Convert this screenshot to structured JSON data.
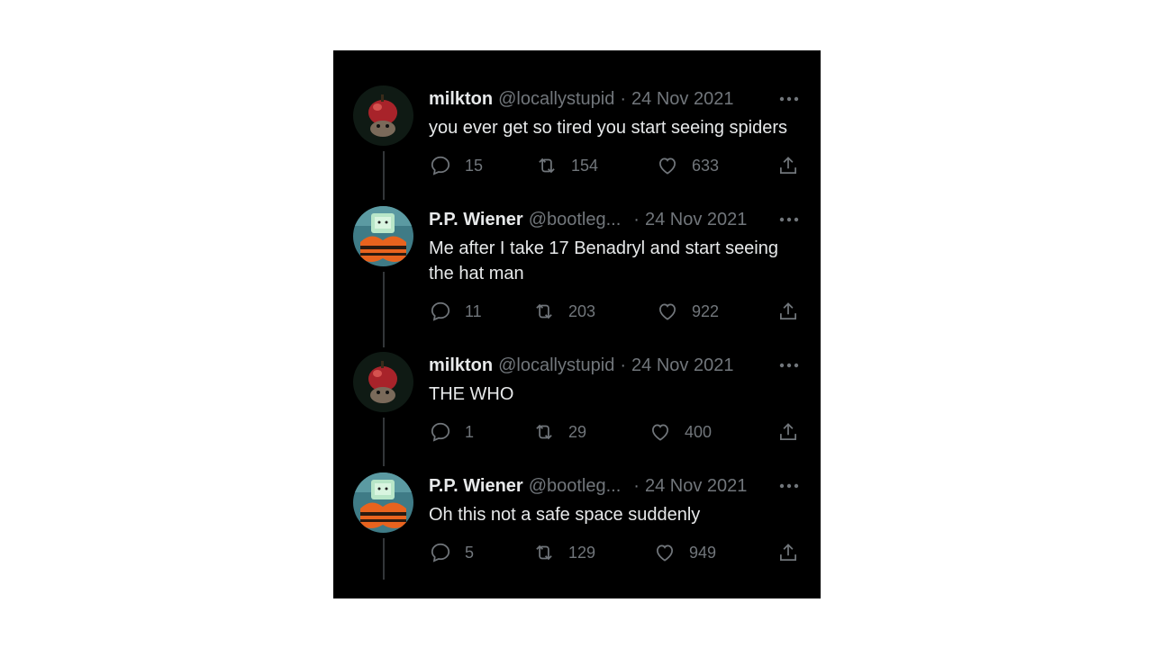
{
  "thread": [
    {
      "name": "milkton",
      "handle": "@locallystupid",
      "separator": "·",
      "date": "24 Nov 2021",
      "text": "you ever get so tired you start seeing spiders",
      "replies": "15",
      "retweets": "154",
      "likes": "633",
      "avatar_icon": "avatar-milkton"
    },
    {
      "name": "P.P. Wiener",
      "handle": "@bootleg...",
      "separator": "·",
      "date": "24 Nov 2021",
      "text": "Me after I take 17 Benadryl and start seeing the hat man",
      "replies": "11",
      "retweets": "203",
      "likes": "922",
      "avatar_icon": "avatar-pp-wiener"
    },
    {
      "name": "milkton",
      "handle": "@locallystupid",
      "separator": "·",
      "date": "24 Nov 2021",
      "text": "THE WHO",
      "replies": "1",
      "retweets": "29",
      "likes": "400",
      "avatar_icon": "avatar-milkton"
    },
    {
      "name": "P.P. Wiener",
      "handle": "@bootleg...",
      "separator": "·",
      "date": "24 Nov 2021",
      "text": "Oh this not a safe space suddenly",
      "replies": "5",
      "retweets": "129",
      "likes": "949",
      "avatar_icon": "avatar-pp-wiener"
    }
  ],
  "colors": {
    "background": "#000000",
    "text_primary": "#e7e9ea",
    "text_secondary": "#71767b",
    "thread_line": "#333639"
  }
}
